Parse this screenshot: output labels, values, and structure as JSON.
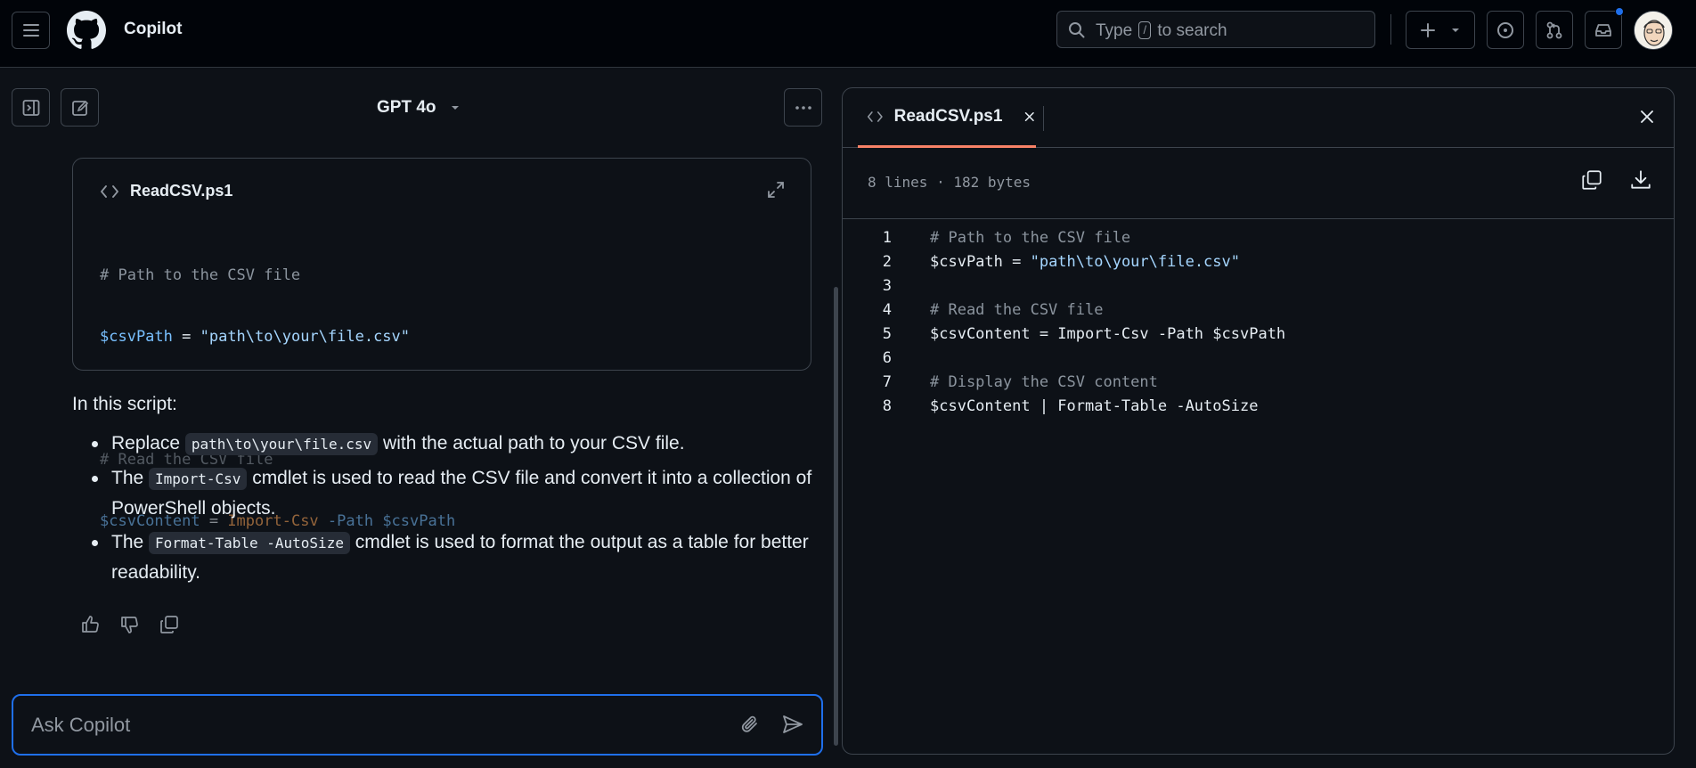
{
  "header": {
    "app_title": "Copilot",
    "search": {
      "prefix": "Type",
      "key": "/",
      "suffix": "to search"
    }
  },
  "toolbar": {
    "model": "GPT 4o"
  },
  "code_card": {
    "filename": "ReadCSV.ps1",
    "lines": [
      "# Path to the CSV file",
      "$csvPath = \"path\\to\\your\\file.csv\"",
      "",
      "# Read the CSV file",
      "$csvContent = Import-Csv -Path $csvPath"
    ]
  },
  "message": {
    "intro": "In this script:",
    "bullets": [
      {
        "pre": "Replace ",
        "code": "path\\to\\your\\file.csv",
        "post": " with the actual path to your CSV file."
      },
      {
        "pre": "The ",
        "code": "Import-Csv",
        "post": " cmdlet is used to read the CSV file and convert it into a collection of PowerShell objects."
      },
      {
        "pre": "The ",
        "code": "Format-Table -AutoSize",
        "post": " cmdlet is used to format the output as a table for better readability."
      }
    ]
  },
  "input": {
    "placeholder": "Ask Copilot"
  },
  "file_viewer": {
    "tab_label": "ReadCSV.ps1",
    "meta": "8 lines · 182 bytes",
    "lines": [
      {
        "n": "1",
        "text": "# Path to the CSV file",
        "type": "comment"
      },
      {
        "n": "2",
        "text": "$csvPath = \"path\\to\\your\\file.csv\"",
        "type": "assign"
      },
      {
        "n": "3",
        "text": "",
        "type": "blank"
      },
      {
        "n": "4",
        "text": "# Read the CSV file",
        "type": "comment"
      },
      {
        "n": "5",
        "text": "$csvContent = Import-Csv -Path $csvPath",
        "type": "plain"
      },
      {
        "n": "6",
        "text": "",
        "type": "blank"
      },
      {
        "n": "7",
        "text": "# Display the CSV content",
        "type": "comment"
      },
      {
        "n": "8",
        "text": "$csvContent | Format-Table -AutoSize",
        "type": "plain"
      }
    ]
  },
  "colors": {
    "accent": "#1f6feb",
    "tab_underline": "#f78166",
    "background": "#0d1117"
  }
}
